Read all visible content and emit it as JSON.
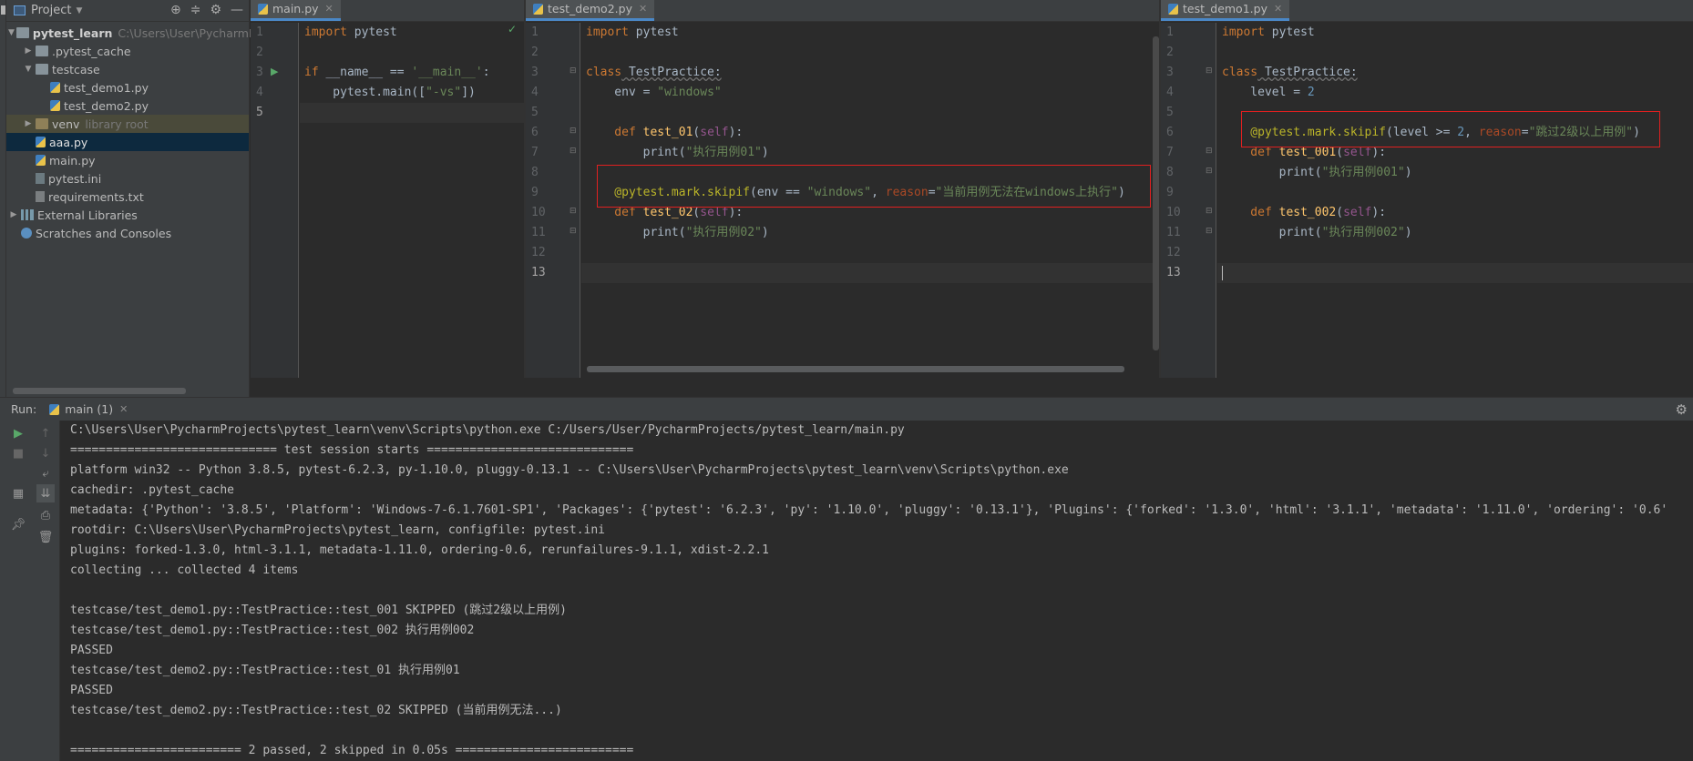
{
  "project_panel": {
    "title": "Project",
    "tree": [
      {
        "name": "pytest_learn",
        "note": "C:\\Users\\User\\PycharmPr"
      },
      {
        "name": ".pytest_cache"
      },
      {
        "name": "testcase"
      },
      {
        "name": "test_demo1.py"
      },
      {
        "name": "test_demo2.py"
      },
      {
        "name": "venv",
        "note": "library root"
      },
      {
        "name": "aaa.py"
      },
      {
        "name": "main.py"
      },
      {
        "name": "pytest.ini"
      },
      {
        "name": "requirements.txt"
      },
      {
        "name": "External Libraries"
      },
      {
        "name": "Scratches and Consoles"
      }
    ]
  },
  "editors": {
    "main": {
      "tab": "main.py",
      "line_numbers": [
        "1",
        "2",
        "3",
        "4",
        "5"
      ],
      "code": {
        "l1_kw": "import",
        "l1_rest": " pytest",
        "l3_kw": "if",
        "l3_a": " __name__ == ",
        "l3_str": "'__main__'",
        "l3_b": ":",
        "l4_a": "    pytest.main([",
        "l4_str": "\"-vs\"",
        "l4_b": "])"
      }
    },
    "demo2": {
      "tab": "test_demo2.py",
      "line_numbers": [
        "1",
        "2",
        "3",
        "4",
        "5",
        "6",
        "7",
        "8",
        "9",
        "10",
        "11",
        "12",
        "13"
      ],
      "code": {
        "l1_kw": "import",
        "l1_rest": " pytest",
        "l3_kw": "class",
        "l3_cls": " TestPractice:",
        "l4_a": "    env = ",
        "l4_str": "\"windows\"",
        "l6_kw": "    def",
        "l6_fn": " test_01",
        "l6_a": "(",
        "l6_self": "self",
        "l6_b": "):",
        "l7_a": "        print(",
        "l7_str": "\"执行用例01\"",
        "l7_b": ")",
        "l9_dec": "    @pytest.mark.skipif",
        "l9_a": "(env == ",
        "l9_str": "\"windows\"",
        "l9_b": ", ",
        "l9_kwa": "reason",
        "l9_c": "=",
        "l9_str2": "\"当前用例无法在windows上执行\"",
        "l9_d": ")",
        "l10_kw": "    def",
        "l10_fn": " test_02",
        "l10_a": "(",
        "l10_self": "self",
        "l10_b": "):",
        "l11_a": "        print(",
        "l11_str": "\"执行用例02\"",
        "l11_b": ")"
      }
    },
    "demo1": {
      "tab": "test_demo1.py",
      "line_numbers": [
        "1",
        "2",
        "3",
        "4",
        "5",
        "6",
        "7",
        "8",
        "9",
        "10",
        "11",
        "12",
        "13"
      ],
      "code": {
        "l1_kw": "import",
        "l1_rest": " pytest",
        "l3_kw": "class",
        "l3_cls": " TestPractice:",
        "l4_a": "    level = ",
        "l4_num": "2",
        "l6_dec": "    @pytest.mark.skipif",
        "l6_a": "(level >= ",
        "l6_num": "2",
        "l6_b": ", ",
        "l6_kwa": "reason",
        "l6_c": "=",
        "l6_str": "\"跳过2级以上用例\"",
        "l6_d": ")",
        "l7_kw": "    def",
        "l7_fn": " test_001",
        "l7_a": "(",
        "l7_self": "self",
        "l7_b": "):",
        "l8_a": "        print(",
        "l8_str": "\"执行用例001\"",
        "l8_b": ")",
        "l10_kw": "    def",
        "l10_fn": " test_002",
        "l10_a": "(",
        "l10_self": "self",
        "l10_b": "):",
        "l11_a": "        print(",
        "l11_str": "\"执行用例002\"",
        "l11_b": ")"
      }
    }
  },
  "run": {
    "label": "Run:",
    "tab": "main (1)",
    "console_lines": [
      "C:\\Users\\User\\PycharmProjects\\pytest_learn\\venv\\Scripts\\python.exe C:/Users/User/PycharmProjects/pytest_learn/main.py",
      "============================= test session starts =============================",
      "platform win32 -- Python 3.8.5, pytest-6.2.3, py-1.10.0, pluggy-0.13.1 -- C:\\Users\\User\\PycharmProjects\\pytest_learn\\venv\\Scripts\\python.exe",
      "cachedir: .pytest_cache",
      "metadata: {'Python': '3.8.5', 'Platform': 'Windows-7-6.1.7601-SP1', 'Packages': {'pytest': '6.2.3', 'py': '1.10.0', 'pluggy': '0.13.1'}, 'Plugins': {'forked': '1.3.0', 'html': '3.1.1', 'metadata': '1.11.0', 'ordering': '0.6'",
      "rootdir: C:\\Users\\User\\PycharmProjects\\pytest_learn, configfile: pytest.ini",
      "plugins: forked-1.3.0, html-3.1.1, metadata-1.11.0, ordering-0.6, rerunfailures-9.1.1, xdist-2.2.1",
      "collecting ... collected 4 items",
      "",
      "testcase/test_demo1.py::TestPractice::test_001 SKIPPED (跳过2级以上用例)",
      "testcase/test_demo1.py::TestPractice::test_002 执行用例002",
      "PASSED",
      "testcase/test_demo2.py::TestPractice::test_01 执行用例01",
      "PASSED",
      "testcase/test_demo2.py::TestPractice::test_02 SKIPPED (当前用例无法...)",
      "",
      "======================== 2 passed, 2 skipped in 0.05s ========================="
    ]
  },
  "colors": {
    "background": "#2b2b2b",
    "panel": "#3c3f41",
    "keyword": "#cc7832",
    "string": "#6a8759",
    "function": "#ffc66d",
    "decorator": "#bbb529",
    "highlight_box": "#e02020"
  }
}
